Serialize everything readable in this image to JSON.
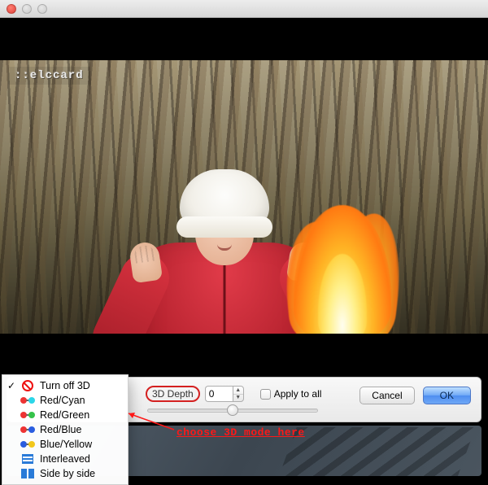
{
  "titlebar": {},
  "watermark": "::elccard",
  "panel": {
    "depth_label": "3D Depth",
    "depth_value": "0",
    "apply_all_label": "Apply to all",
    "apply_all_checked": false,
    "cancel_label": "Cancel",
    "ok_label": "OK"
  },
  "menu": {
    "items": [
      {
        "label": "Turn off 3D",
        "icon": "off",
        "checked": true
      },
      {
        "label": "Red/Cyan",
        "icon": "redcyan",
        "checked": false
      },
      {
        "label": "Red/Green",
        "icon": "redgreen",
        "checked": false
      },
      {
        "label": "Red/Blue",
        "icon": "redblue",
        "checked": false
      },
      {
        "label": "Blue/Yellow",
        "icon": "blueyellow",
        "checked": false
      },
      {
        "label": "Interleaved",
        "icon": "interleaved",
        "checked": false
      },
      {
        "label": "Side by side",
        "icon": "sbs",
        "checked": false
      }
    ]
  },
  "annotation": {
    "text": "choose 3D mode here"
  }
}
